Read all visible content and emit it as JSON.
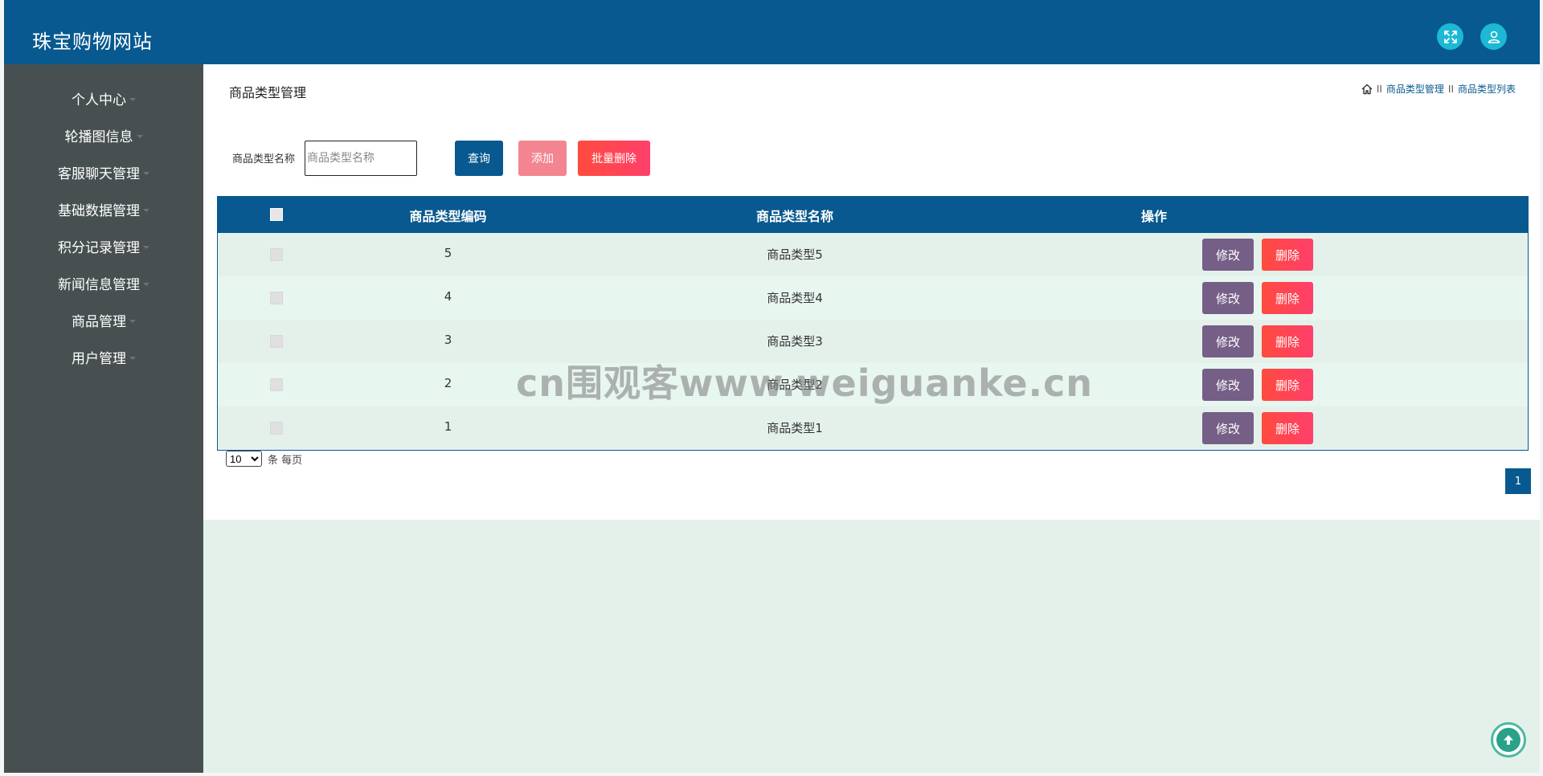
{
  "header": {
    "site_title": "珠宝购物网站",
    "expand_icon": "expand-arrows-icon",
    "user_icon": "user-icon"
  },
  "sidebar": {
    "items": [
      {
        "label": "个人中心"
      },
      {
        "label": "轮播图信息"
      },
      {
        "label": "客服聊天管理"
      },
      {
        "label": "基础数据管理"
      },
      {
        "label": "积分记录管理"
      },
      {
        "label": "新闻信息管理"
      },
      {
        "label": "商品管理"
      },
      {
        "label": "用户管理"
      }
    ]
  },
  "main": {
    "page_title": "商品类型管理",
    "breadcrumb": {
      "home_icon": "home-icon",
      "sep": "II",
      "level1": "商品类型管理",
      "level2": "商品类型列表"
    },
    "search": {
      "label": "商品类型名称",
      "placeholder": "商品类型名称",
      "query_label": "查询",
      "add_label": "添加",
      "batch_delete_label": "批量删除"
    },
    "table": {
      "headers": [
        "商品类型编码",
        "商品类型名称",
        "操作"
      ],
      "rows": [
        {
          "code": "5",
          "name": "商品类型5"
        },
        {
          "code": "4",
          "name": "商品类型4"
        },
        {
          "code": "3",
          "name": "商品类型3"
        },
        {
          "code": "2",
          "name": "商品类型2"
        },
        {
          "code": "1",
          "name": "商品类型1"
        }
      ],
      "edit_label": "修改",
      "delete_label": "删除"
    },
    "pagination": {
      "page_size": "10",
      "per_page_text": "条 每页",
      "current_page": "1"
    }
  },
  "watermark": "cn围观客www.weiguanke.cn",
  "colors": {
    "primary": "#08598f",
    "sidebar": "#474f51",
    "edit": "#755f86",
    "delete": "#ff4b3e",
    "add": "#f28590",
    "row_bg": "#e4f1eb"
  }
}
